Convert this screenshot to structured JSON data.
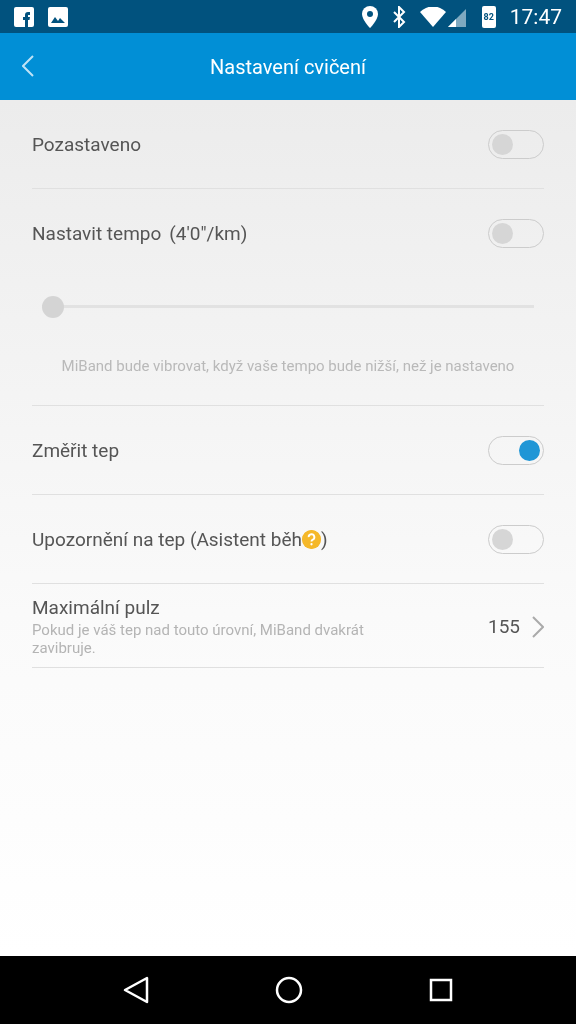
{
  "status_bar": {
    "time": "17:47",
    "battery": "82"
  },
  "app_bar": {
    "title": "Nastavení cvičení"
  },
  "settings": [
    {
      "kind": "toggle",
      "label": "Pozastaveno",
      "on": false,
      "divider": true
    },
    {
      "kind": "toggle",
      "label": "Nastavit tempo",
      "extra": "(4'0\"/km)",
      "on": false,
      "divider": false
    },
    {
      "kind": "slider",
      "level": 0.0,
      "divider": false
    },
    {
      "kind": "note",
      "text": "MiBand bude vibrovat, když vaše tempo bude nižší, než je nastaveno",
      "divider": true
    },
    {
      "kind": "toggle",
      "label": "Změřit tep",
      "on": true,
      "divider": true
    },
    {
      "kind": "toggle",
      "label": "Upozornění na tep (Asistent běh",
      "help": true,
      "suffix": ")",
      "on": false,
      "divider": true
    },
    {
      "kind": "value",
      "label": "Maximální pulz",
      "description": "Pokud je váš tep nad touto úrovní, MiBand dvakrát zavibruje.",
      "value": "155",
      "divider": true
    }
  ]
}
